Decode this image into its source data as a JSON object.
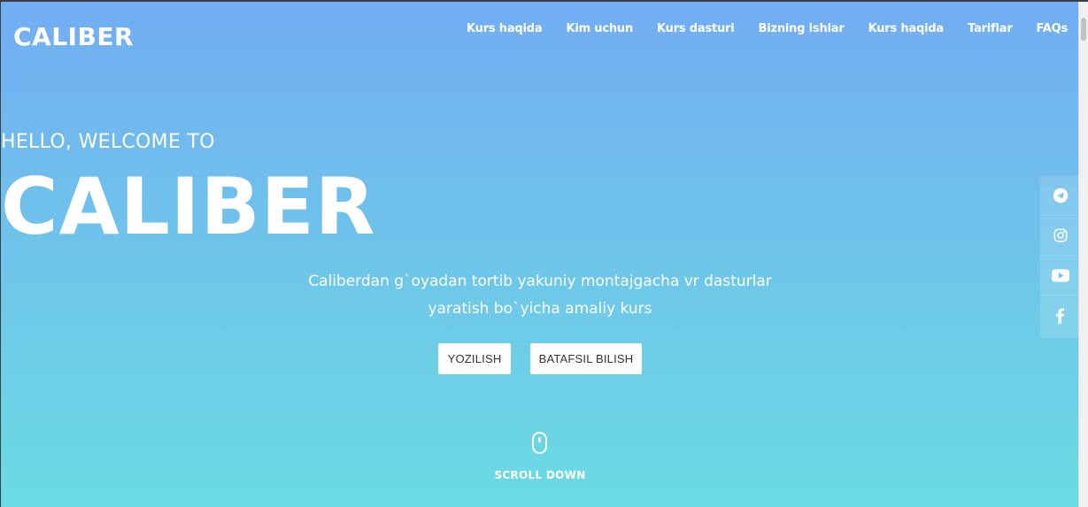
{
  "brand": {
    "logo": "CALIBER"
  },
  "nav": {
    "items": [
      {
        "label": "Kurs haqida"
      },
      {
        "label": "Kim uchun"
      },
      {
        "label": "Kurs dasturi"
      },
      {
        "label": "Bizning ishlar"
      },
      {
        "label": "Kurs haqida"
      },
      {
        "label": "Tariflar"
      },
      {
        "label": "FAQs"
      }
    ]
  },
  "hero": {
    "greeting": "HELLO, WELCOME TO",
    "title": "CALIBER",
    "subtitle": "Caliberdan g`oyadan tortib yakuniy montajgacha vr dasturlar yaratish bo`yicha amaliy kurs",
    "primary_button": "YOZILISH",
    "secondary_button": "BATAFSIL BILISH",
    "scroll_label": "SCROLL DOWN"
  },
  "social": {
    "icons": [
      "telegram-icon",
      "instagram-icon",
      "youtube-icon",
      "facebook-icon"
    ]
  },
  "colors": {
    "gradient_top": "#72adf3",
    "gradient_bottom": "#6bdbe2",
    "text": "#ffffff"
  }
}
